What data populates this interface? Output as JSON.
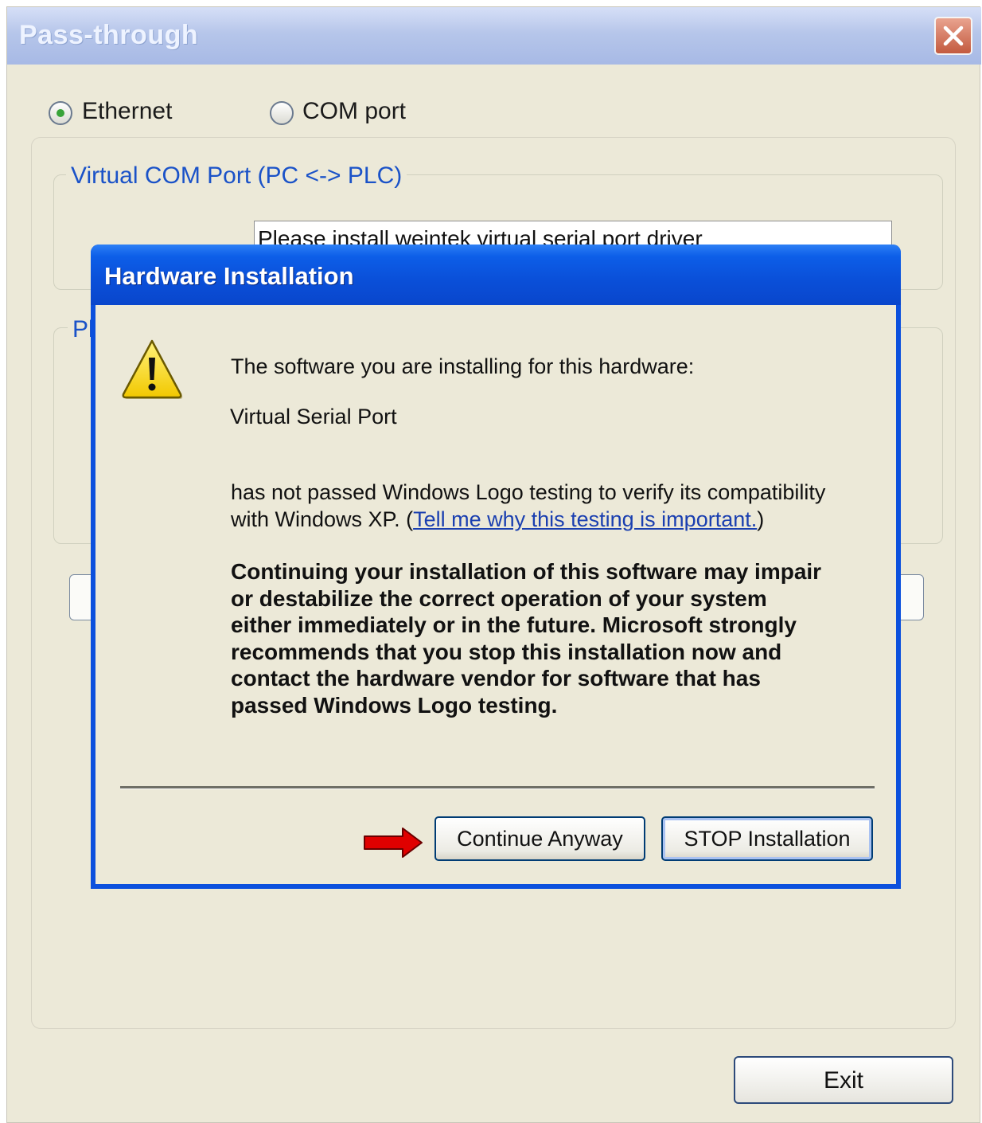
{
  "window": {
    "title": "Pass-through",
    "close_icon": "close-icon"
  },
  "connection": {
    "ethernet_label": "Ethernet",
    "ethernet_selected": true,
    "com_label": "COM port",
    "com_selected": false
  },
  "virtual_com": {
    "group_title": "Virtual COM Port (PC <-> PLC)",
    "status_text": "Please install weintek virtual serial port driver"
  },
  "second_group": {
    "title_partial": "Pl"
  },
  "exit_label": "Exit",
  "dialog": {
    "title": "Hardware Installation",
    "icon": "warning-icon",
    "line1": "The software you are installing for this hardware:",
    "device": "Virtual Serial Port",
    "logo_text_1": "has not passed Windows Logo testing to verify its compatibility",
    "logo_text_2": "with Windows XP. (",
    "link_text": "Tell me why this testing is important.",
    "logo_text_close": ")",
    "warning_lines": [
      "Continuing your installation of this software may impair",
      "or destabilize the correct operation of your system",
      "either immediately or in the future. Microsoft strongly",
      "recommends that you stop this installation now and",
      "contact the hardware vendor for software that has",
      "passed Windows Logo testing."
    ],
    "continue_label": "Continue Anyway",
    "stop_label": "STOP Installation"
  },
  "colors": {
    "dialog_title_blue": "#0a4fd8",
    "window_bg": "#ece9d8",
    "link_blue": "#1a3fb0",
    "annotation_arrow": "#e00000"
  }
}
